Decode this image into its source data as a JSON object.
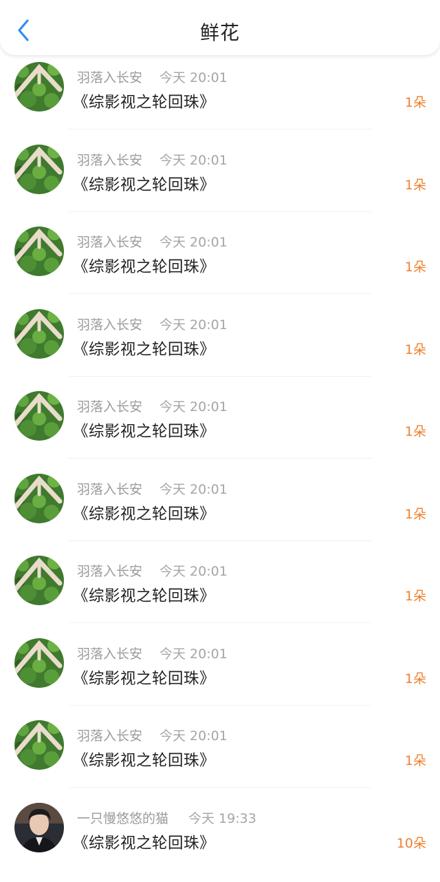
{
  "header": {
    "title": "鲜花",
    "back_icon": "chevron-left-icon",
    "accent_color": "#2f8cf5"
  },
  "colors": {
    "count": "#f07f2e",
    "meta": "#9b9b9b",
    "text": "#222222"
  },
  "gifts": [
    {
      "user": "羽落入长安",
      "time": "今天 20:01",
      "book": "《综影视之轮回珠》",
      "count": "1朵",
      "avatar": "heart-hands-plant-avatar"
    },
    {
      "user": "羽落入长安",
      "time": "今天 20:01",
      "book": "《综影视之轮回珠》",
      "count": "1朵",
      "avatar": "heart-hands-plant-avatar"
    },
    {
      "user": "羽落入长安",
      "time": "今天 20:01",
      "book": "《综影视之轮回珠》",
      "count": "1朵",
      "avatar": "heart-hands-plant-avatar"
    },
    {
      "user": "羽落入长安",
      "time": "今天 20:01",
      "book": "《综影视之轮回珠》",
      "count": "1朵",
      "avatar": "heart-hands-plant-avatar"
    },
    {
      "user": "羽落入长安",
      "time": "今天 20:01",
      "book": "《综影视之轮回珠》",
      "count": "1朵",
      "avatar": "heart-hands-plant-avatar"
    },
    {
      "user": "羽落入长安",
      "time": "今天 20:01",
      "book": "《综影视之轮回珠》",
      "count": "1朵",
      "avatar": "heart-hands-plant-avatar"
    },
    {
      "user": "羽落入长安",
      "time": "今天 20:01",
      "book": "《综影视之轮回珠》",
      "count": "1朵",
      "avatar": "heart-hands-plant-avatar"
    },
    {
      "user": "羽落入长安",
      "time": "今天 20:01",
      "book": "《综影视之轮回珠》",
      "count": "1朵",
      "avatar": "heart-hands-plant-avatar"
    },
    {
      "user": "羽落入长安",
      "time": "今天 20:01",
      "book": "《综影视之轮回珠》",
      "count": "1朵",
      "avatar": "heart-hands-plant-avatar"
    },
    {
      "user": "一只慢悠悠的猫",
      "time": "今天 19:33",
      "book": "《综影视之轮回珠》",
      "count": "10朵",
      "avatar": "person-portrait-avatar"
    }
  ]
}
